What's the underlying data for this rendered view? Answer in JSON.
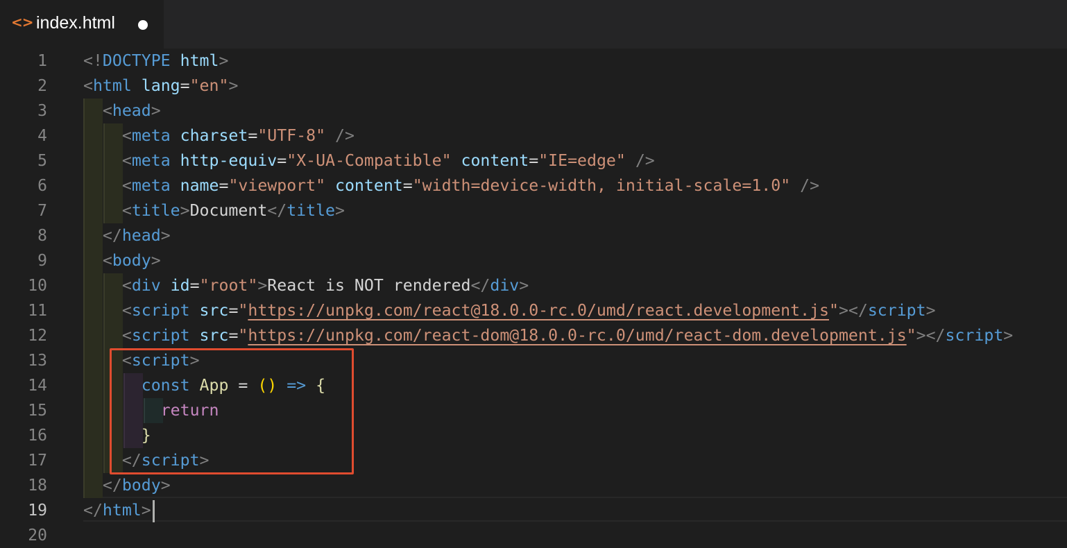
{
  "tab": {
    "icon": "code-brackets-icon",
    "icon_glyph": "<>",
    "label": "index.html",
    "unsaved": true
  },
  "line_numbers": [
    "1",
    "2",
    "3",
    "4",
    "5",
    "6",
    "7",
    "8",
    "9",
    "10",
    "11",
    "12",
    "13",
    "14",
    "15",
    "16",
    "17",
    "18",
    "19",
    "20"
  ],
  "lines": [
    [
      [
        "punc",
        "<!"
      ],
      [
        "tag",
        "DOCTYPE"
      ],
      [
        "text",
        " "
      ],
      [
        "attr",
        "html"
      ],
      [
        "punc",
        ">"
      ]
    ],
    [
      [
        "punc",
        "<"
      ],
      [
        "tag",
        "html"
      ],
      [
        "text",
        " "
      ],
      [
        "attr",
        "lang"
      ],
      [
        "text",
        "="
      ],
      [
        "str",
        "\"en\""
      ],
      [
        "punc",
        ">"
      ]
    ],
    [
      [
        "text",
        "  "
      ],
      [
        "punc",
        "<"
      ],
      [
        "tag",
        "head"
      ],
      [
        "punc",
        ">"
      ]
    ],
    [
      [
        "text",
        "    "
      ],
      [
        "punc",
        "<"
      ],
      [
        "tag",
        "meta"
      ],
      [
        "text",
        " "
      ],
      [
        "attr",
        "charset"
      ],
      [
        "text",
        "="
      ],
      [
        "str",
        "\"UTF-8\""
      ],
      [
        "text",
        " "
      ],
      [
        "punc",
        "/>"
      ]
    ],
    [
      [
        "text",
        "    "
      ],
      [
        "punc",
        "<"
      ],
      [
        "tag",
        "meta"
      ],
      [
        "text",
        " "
      ],
      [
        "attr",
        "http-equiv"
      ],
      [
        "text",
        "="
      ],
      [
        "str",
        "\"X-UA-Compatible\""
      ],
      [
        "text",
        " "
      ],
      [
        "attr",
        "content"
      ],
      [
        "text",
        "="
      ],
      [
        "str",
        "\"IE=edge\""
      ],
      [
        "text",
        " "
      ],
      [
        "punc",
        "/>"
      ]
    ],
    [
      [
        "text",
        "    "
      ],
      [
        "punc",
        "<"
      ],
      [
        "tag",
        "meta"
      ],
      [
        "text",
        " "
      ],
      [
        "attr",
        "name"
      ],
      [
        "text",
        "="
      ],
      [
        "str",
        "\"viewport\""
      ],
      [
        "text",
        " "
      ],
      [
        "attr",
        "content"
      ],
      [
        "text",
        "="
      ],
      [
        "str",
        "\"width=device-width, initial-scale=1.0\""
      ],
      [
        "text",
        " "
      ],
      [
        "punc",
        "/>"
      ]
    ],
    [
      [
        "text",
        "    "
      ],
      [
        "punc",
        "<"
      ],
      [
        "tag",
        "title"
      ],
      [
        "punc",
        ">"
      ],
      [
        "text",
        "Document"
      ],
      [
        "punc",
        "</"
      ],
      [
        "tag",
        "title"
      ],
      [
        "punc",
        ">"
      ]
    ],
    [
      [
        "text",
        "  "
      ],
      [
        "punc",
        "</"
      ],
      [
        "tag",
        "head"
      ],
      [
        "punc",
        ">"
      ]
    ],
    [
      [
        "text",
        "  "
      ],
      [
        "punc",
        "<"
      ],
      [
        "tag",
        "body"
      ],
      [
        "punc",
        ">"
      ]
    ],
    [
      [
        "text",
        "    "
      ],
      [
        "punc",
        "<"
      ],
      [
        "tag",
        "div"
      ],
      [
        "text",
        " "
      ],
      [
        "attr",
        "id"
      ],
      [
        "text",
        "="
      ],
      [
        "str",
        "\"root\""
      ],
      [
        "punc",
        ">"
      ],
      [
        "text",
        "React is NOT rendered"
      ],
      [
        "punc",
        "</"
      ],
      [
        "tag",
        "div"
      ],
      [
        "punc",
        ">"
      ]
    ],
    [
      [
        "text",
        "    "
      ],
      [
        "punc",
        "<"
      ],
      [
        "tag",
        "script"
      ],
      [
        "text",
        " "
      ],
      [
        "attr",
        "src"
      ],
      [
        "text",
        "="
      ],
      [
        "str",
        "\""
      ],
      [
        "link",
        "https://unpkg.com/react@18.0.0-rc.0/umd/react.development.js"
      ],
      [
        "str",
        "\""
      ],
      [
        "punc",
        "></"
      ],
      [
        "tag",
        "script"
      ],
      [
        "punc",
        ">"
      ]
    ],
    [
      [
        "text",
        "    "
      ],
      [
        "punc",
        "<"
      ],
      [
        "tag",
        "script"
      ],
      [
        "text",
        " "
      ],
      [
        "attr",
        "src"
      ],
      [
        "text",
        "="
      ],
      [
        "str",
        "\""
      ],
      [
        "link",
        "https://unpkg.com/react-dom@18.0.0-rc.0/umd/react-dom.development.js"
      ],
      [
        "str",
        "\""
      ],
      [
        "punc",
        "></"
      ],
      [
        "tag",
        "script"
      ],
      [
        "punc",
        ">"
      ]
    ],
    [
      [
        "text",
        "    "
      ],
      [
        "punc",
        "<"
      ],
      [
        "tag",
        "script"
      ],
      [
        "punc",
        ">"
      ]
    ],
    [
      [
        "text",
        "      "
      ],
      [
        "kw",
        "const"
      ],
      [
        "text",
        " "
      ],
      [
        "fn",
        "App"
      ],
      [
        "text",
        " = "
      ],
      [
        "paren",
        "()"
      ],
      [
        "text",
        " "
      ],
      [
        "kw",
        "=>"
      ],
      [
        "text",
        " "
      ],
      [
        "brace",
        "{"
      ]
    ],
    [
      [
        "text",
        "        "
      ],
      [
        "ret",
        "return"
      ]
    ],
    [
      [
        "text",
        "      "
      ],
      [
        "brace",
        "}"
      ]
    ],
    [
      [
        "text",
        "    "
      ],
      [
        "punc",
        "</"
      ],
      [
        "tag",
        "script"
      ],
      [
        "punc",
        ">"
      ]
    ],
    [
      [
        "text",
        "  "
      ],
      [
        "punc",
        "</"
      ],
      [
        "tag",
        "body"
      ],
      [
        "punc",
        ">"
      ]
    ],
    [
      [
        "punc",
        "</"
      ],
      [
        "tag",
        "html"
      ],
      [
        "punc",
        ">"
      ]
    ],
    []
  ],
  "active_line": 19,
  "colors": {
    "highlight_box": "#e04c2f",
    "background": "#1e1e1e",
    "tag": "#569cd6",
    "attribute": "#9cdcfe",
    "string": "#ce9178"
  }
}
